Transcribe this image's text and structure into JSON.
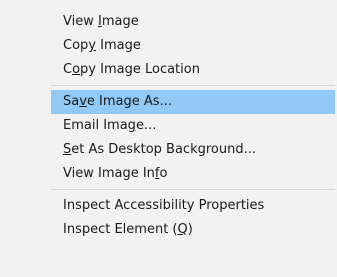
{
  "menu": {
    "items": [
      {
        "pre": "View ",
        "acc": "I",
        "post": "mage"
      },
      {
        "pre": "Cop",
        "acc": "y",
        "post": " Image"
      },
      {
        "pre": "C",
        "acc": "o",
        "post": "py Image Location"
      },
      {
        "pre": "Sa",
        "acc": "v",
        "post": "e Image As..."
      },
      {
        "pre": "Email Ima",
        "acc": "g",
        "post": "e..."
      },
      {
        "pre": "",
        "acc": "S",
        "post": "et As Desktop Background..."
      },
      {
        "pre": "View Image In",
        "acc": "f",
        "post": "o"
      },
      {
        "pre": "Inspect Accessibility Properties",
        "acc": "",
        "post": ""
      },
      {
        "pre": "Inspect Element (",
        "acc": "Q",
        "post": ")"
      }
    ],
    "highlighted_color": "#91c9f7",
    "background_color": "#f2f2f2"
  }
}
